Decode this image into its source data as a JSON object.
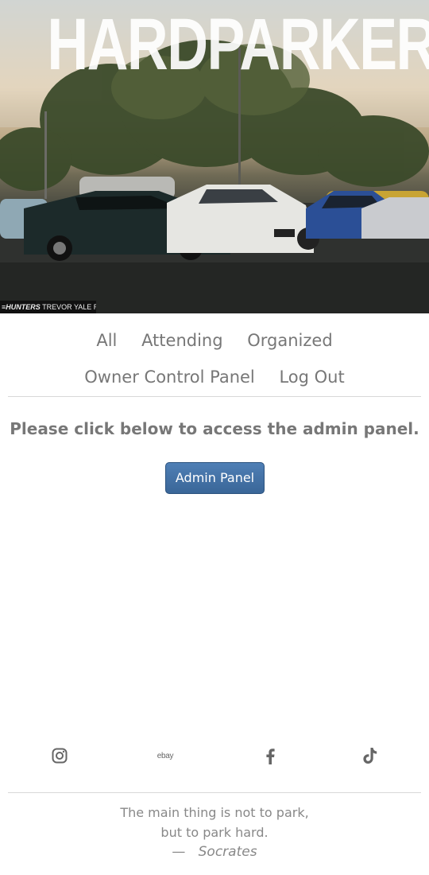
{
  "hero": {
    "title": "HARDPARKERS",
    "photo_credit_brand": "≡HUNTERS",
    "photo_credit_name": "TREVOR YALE RYAN"
  },
  "nav": {
    "row1": [
      "All",
      "Attending",
      "Organized"
    ],
    "row2": [
      "Owner Control Panel",
      "Log Out"
    ]
  },
  "main": {
    "message": "Please click below to access the admin panel.",
    "admin_button": "Admin Panel"
  },
  "social": {
    "instagram_icon": "instagram-icon",
    "ebay_label": "ebay",
    "facebook_icon": "facebook-icon",
    "tiktok_icon": "tiktok-icon"
  },
  "footer": {
    "quote_line1": "The main thing is not to park,",
    "quote_line2": "but to park hard.",
    "dash": "—",
    "author": "Socrates"
  },
  "colors": {
    "button": "#3a6698",
    "text_muted": "#777777"
  }
}
